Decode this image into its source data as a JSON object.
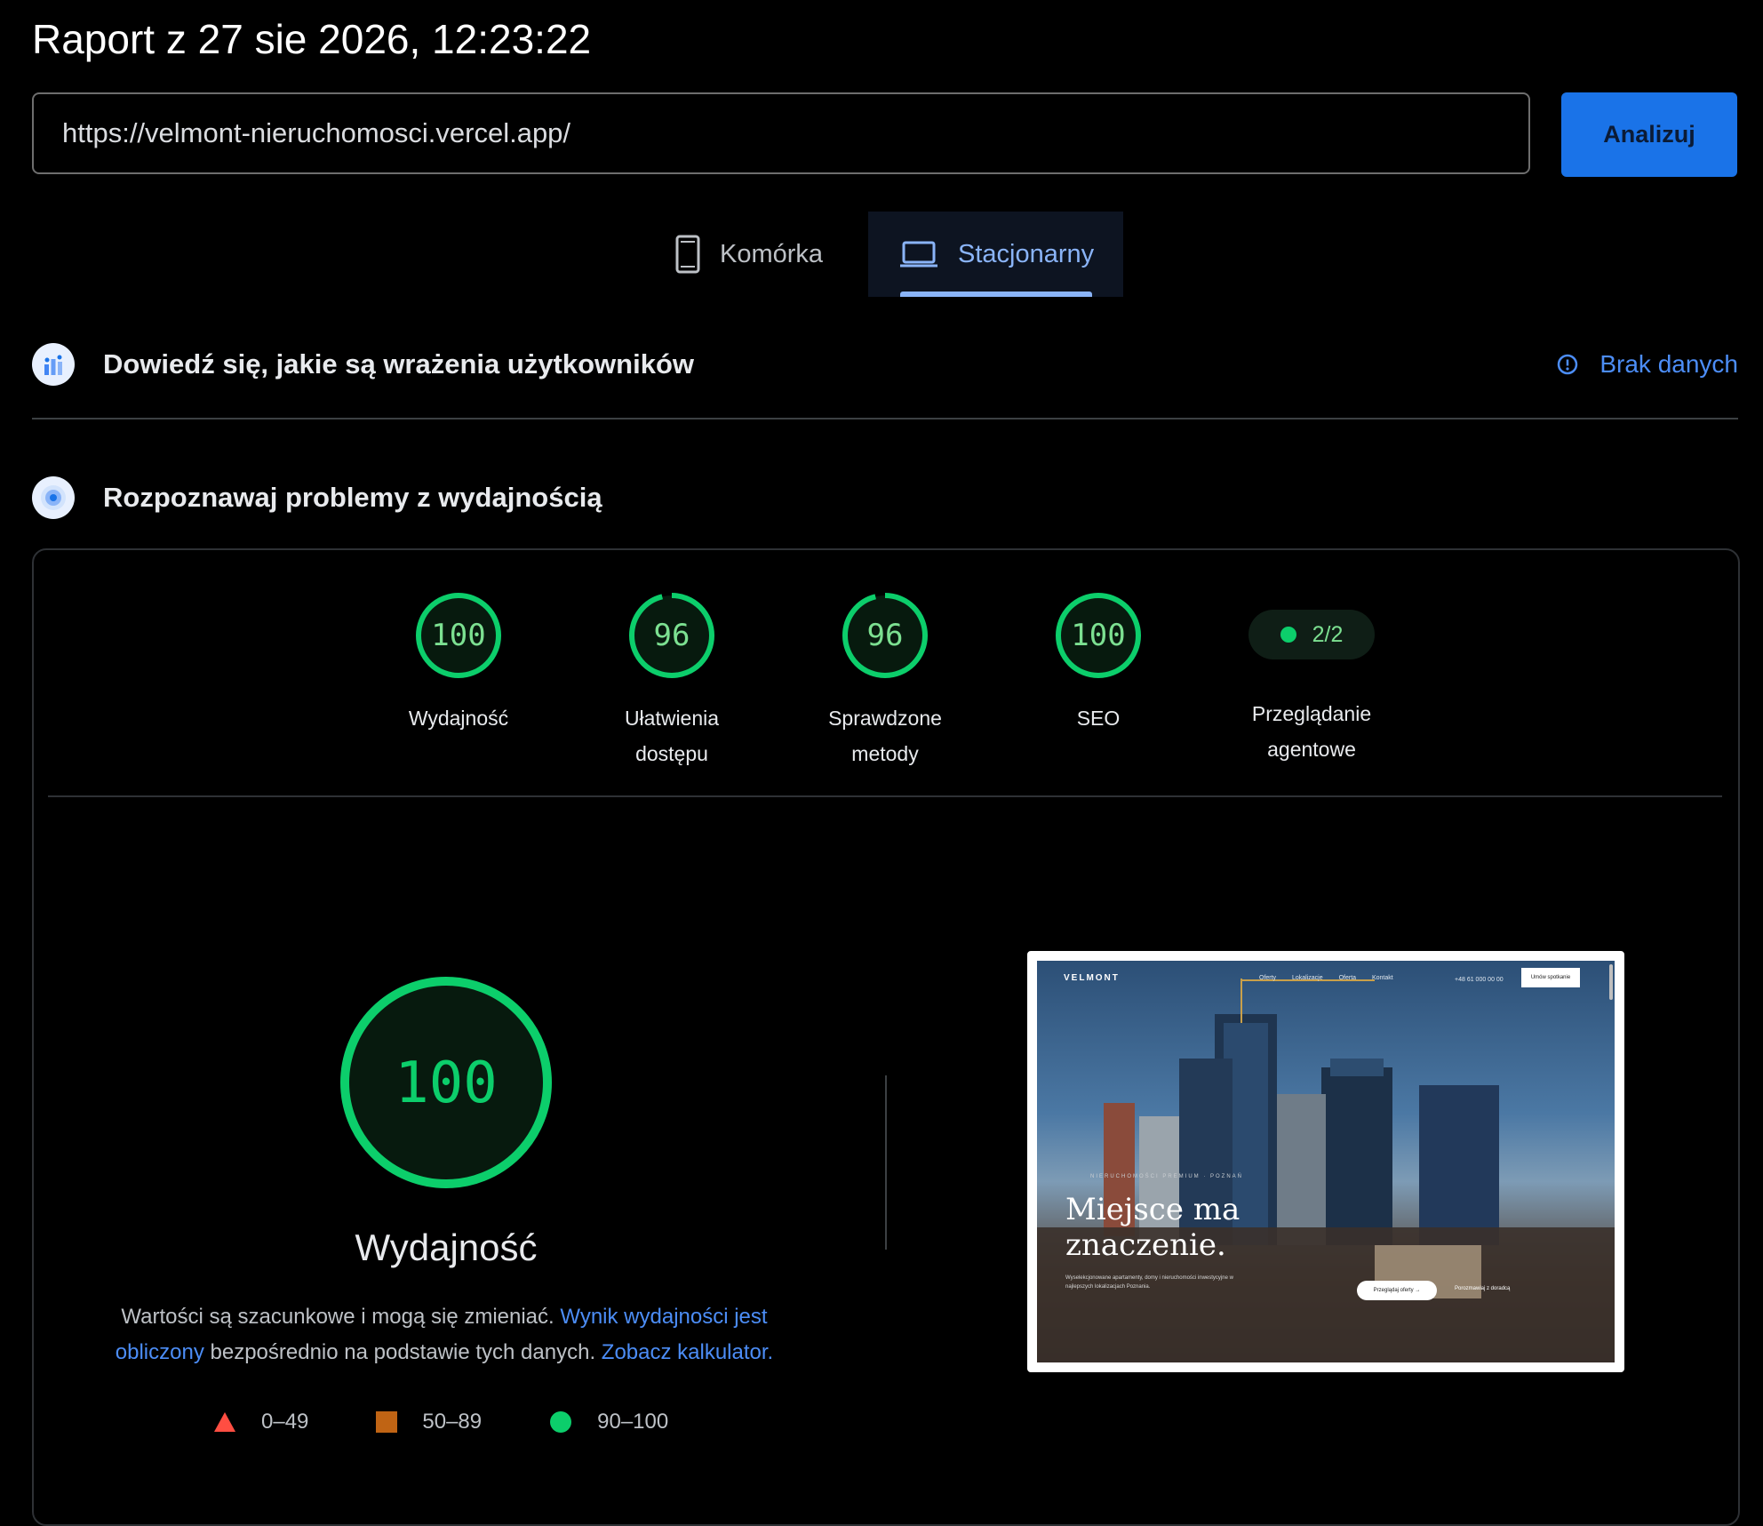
{
  "report": {
    "title": "Raport z 27 sie 2026, 12:23:22"
  },
  "url_form": {
    "value": "https://velmont-nieruchomosci.vercel.app/",
    "analyze_label": "Analizuj"
  },
  "device_tabs": [
    {
      "label": "Komórka",
      "icon": "smartphone-icon",
      "selected": false
    },
    {
      "label": "Stacjonarny",
      "icon": "laptop-icon",
      "selected": true
    }
  ],
  "field_data": {
    "title": "Dowiedź się, jakie są wrażenia użytkowników",
    "status_label": "Brak danych",
    "icon": "crux-chart-icon",
    "status_icon": "info-icon"
  },
  "lab_data": {
    "title": "Rozpoznawaj problemy z wydajnością",
    "icon": "lighthouse-icon"
  },
  "scores": [
    {
      "label_line1": "Wydajność",
      "label_line2": "",
      "score": 100
    },
    {
      "label_line1": "Ułatwienia",
      "label_line2": "dostępu",
      "score": 96
    },
    {
      "label_line1": "Sprawdzone",
      "label_line2": "metody",
      "score": 96
    },
    {
      "label_line1": "SEO",
      "label_line2": "",
      "score": 100
    }
  ],
  "agentic": {
    "value": "2/2",
    "label_line1": "Przeglądanie",
    "label_line2": "agentowe"
  },
  "performance": {
    "score": 100,
    "label": "Wydajność",
    "desc_text1": "Wartości są szacunkowe i mogą się zmieniać. ",
    "desc_link1": "Wynik wydajności jest obliczony",
    "desc_text2": " bezpośrednio na podstawie tych danych. ",
    "desc_link2": "Zobacz kalkulator."
  },
  "legend": [
    {
      "range": "0–49",
      "shape": "triangle",
      "color": "#ff4e42"
    },
    {
      "range": "50–89",
      "shape": "square",
      "color": "#c06414"
    },
    {
      "range": "90–100",
      "shape": "circle",
      "color": "#0cce6b"
    }
  ],
  "screenshot": {
    "brand": "VELMONT",
    "nav": "Oferty Lokalizacje Oferta Kontakt",
    "phone": "+48 61 000 00 00",
    "cta": "Umów spotkanie",
    "tag": "NIERUCHOMOŚCI PREMIUM · POZNAŃ",
    "hero_line1": "Miejsce ma",
    "hero_line2": "znaczenie.",
    "sub": "Wyselekcjonowane apartamenty, domy i nieruchomości inwestycyjne w najlepszych lokalizacjach Poznania.",
    "btn1": "Przeglądaj oferty →",
    "btn2": "Porozmawiaj z doradcą"
  },
  "colors": {
    "accent": "#1a73e8",
    "link": "#4c8df6",
    "pass": "#0cce6b",
    "pass_text": "#7ce091"
  }
}
